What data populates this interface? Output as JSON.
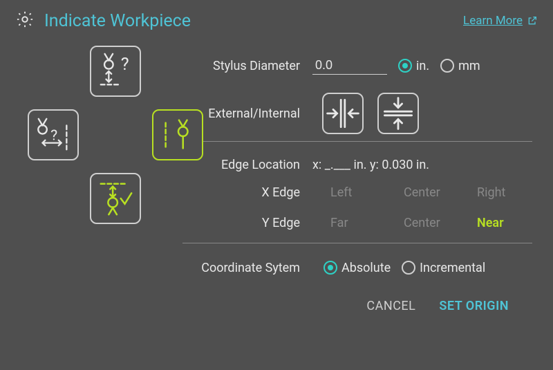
{
  "header": {
    "title": "Indicate Workpiece",
    "learn_more": "Learn More"
  },
  "stylus": {
    "label": "Stylus Diameter",
    "value": "0.0",
    "unit_in": "in.",
    "unit_mm": "mm",
    "unit_selected": "in"
  },
  "ext_int": {
    "label": "External/Internal"
  },
  "edge_location": {
    "label": "Edge Location",
    "value": "x: _.___ in. y: 0.030 in."
  },
  "x_edge": {
    "label": "X Edge",
    "left": "Left",
    "center": "Center",
    "right": "Right",
    "selected": ""
  },
  "y_edge": {
    "label": "Y Edge",
    "far": "Far",
    "center": "Center",
    "near": "Near",
    "selected": "near"
  },
  "coord": {
    "label": "Coordinate Sytem",
    "absolute": "Absolute",
    "incremental": "Incremental",
    "selected": "absolute"
  },
  "footer": {
    "cancel": "CANCEL",
    "set_origin": "SET ORIGIN"
  },
  "icons": {
    "top": "probe-vertical-question",
    "left": "probe-horizontal-question",
    "right": "probe-vertical-active",
    "bottom": "probe-vertical-check"
  }
}
